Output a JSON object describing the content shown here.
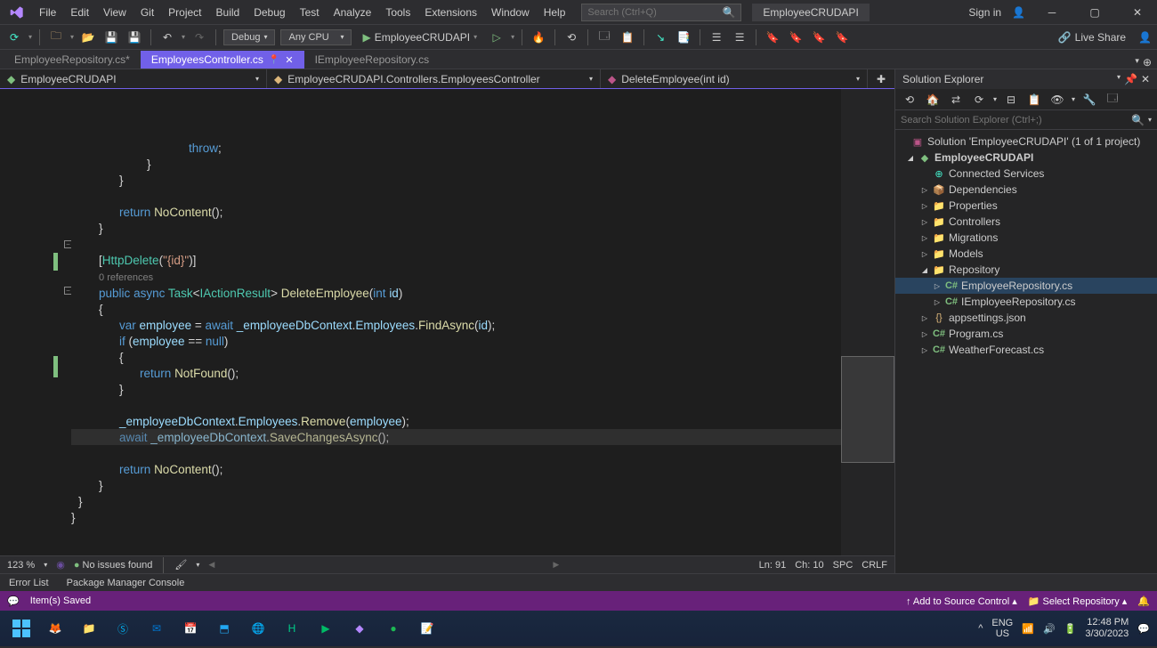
{
  "menus": [
    "File",
    "Edit",
    "View",
    "Git",
    "Project",
    "Build",
    "Debug",
    "Test",
    "Analyze",
    "Tools",
    "Extensions",
    "Window",
    "Help"
  ],
  "search_placeholder": "Search (Ctrl+Q)",
  "solution_label": "EmployeeCRUDAPI",
  "signin": "Sign in",
  "toolbar": {
    "config": "Debug",
    "platform": "Any CPU",
    "run": "EmployeeCRUDAPI",
    "live_share": "Live Share"
  },
  "tabs": [
    {
      "name": "EmployeeRepository.cs*",
      "active": false,
      "pinned": false
    },
    {
      "name": "EmployeesController.cs",
      "active": true,
      "pinned": true
    },
    {
      "name": "IEmployeeRepository.cs",
      "active": false,
      "pinned": false
    }
  ],
  "navbar": {
    "project": "EmployeeCRUDAPI",
    "class": "EmployeeCRUDAPI.Controllers.EmployeesController",
    "member": "DeleteEmployee(int id)"
  },
  "code_lines": [
    {
      "i": 36,
      "t": "                <kw>throw</kw><pun>;</pun>"
    },
    {
      "i": 20,
      "t": "            <pun>}</pun>"
    },
    {
      "i": 12,
      "t": "        <pun>}</pun>"
    },
    {
      "i": 0,
      "t": ""
    },
    {
      "i": 12,
      "t": "        <kw>return</kw> <mth>NoContent</mth><pun>();</pun>"
    },
    {
      "i": 8,
      "t": "    <pun>}</pun>"
    },
    {
      "i": 0,
      "t": ""
    },
    {
      "i": 8,
      "t": "    <pun>[</pun><type>HttpDelete</type><pun>(</pun><str>\"{id}\"</str><pun>)]</pun>"
    },
    {
      "i": 8,
      "t": "    <ref>0 references</ref>"
    },
    {
      "i": 8,
      "t": "    <kw>public</kw> <kw>async</kw> <type>Task</type><pun>&lt;</pun><type>IActionResult</type><pun>&gt;</pun> <mth>DeleteEmployee</mth><pun>(</pun><kw>int</kw> <var>id</var><pun>)</pun>"
    },
    {
      "i": 8,
      "t": "    <pun>{</pun>"
    },
    {
      "i": 12,
      "t": "        <kw>var</kw> <var>employee</var> <pun>=</pun> <kw>await</kw> <var>_employeeDbContext</var><pun>.</pun><var>Employees</var><pun>.</pun><mth>FindAsync</mth><pun>(</pun><var>id</var><pun>);</pun>"
    },
    {
      "i": 12,
      "t": "        <kw>if</kw> <pun>(</pun><var>employee</var> <pun>==</pun> <kw>null</kw><pun>)</pun>"
    },
    {
      "i": 12,
      "t": "        <pun>{</pun>"
    },
    {
      "i": 16,
      "t": "            <kw>return</kw> <mth>NotFound</mth><pun>();</pun>"
    },
    {
      "i": 12,
      "t": "        <pun>}</pun>"
    },
    {
      "i": 0,
      "t": ""
    },
    {
      "i": 12,
      "t": "        <var>_employeeDbContext</var><pun>.</pun><var>Employees</var><pun>.</pun><mth>Remove</mth><pun>(</pun><var>employee</var><pun>);</pun>"
    },
    {
      "i": 12,
      "t": "        <kw>await</kw> <var>_employeeDbContext</var><pun>.</pun><mth>SaveChangesAsync</mth><pun>();</pun>"
    },
    {
      "i": 0,
      "t": ""
    },
    {
      "i": 12,
      "t": "        <kw>return</kw> <mth>NoContent</mth><pun>();</pun>"
    },
    {
      "i": 8,
      "t": "    <pun>}</pun>"
    },
    {
      "i": 4,
      "t": "<pun>}</pun>"
    },
    {
      "i": 0,
      "t": "<pun>}</pun>"
    }
  ],
  "editor_status": {
    "zoom": "123 %",
    "issues": "No issues found",
    "ln": "Ln: 91",
    "ch": "Ch: 10",
    "enc": "SPC",
    "eol": "CRLF"
  },
  "sln": {
    "title": "Solution Explorer",
    "search": "Search Solution Explorer (Ctrl+;)",
    "root": "Solution 'EmployeeCRUDAPI' (1 of 1 project)",
    "project": "EmployeeCRUDAPI",
    "items": [
      {
        "name": "Connected Services",
        "icon": "link",
        "depth": 2,
        "exp": ""
      },
      {
        "name": "Dependencies",
        "icon": "pkg",
        "depth": 2,
        "exp": "▷"
      },
      {
        "name": "Properties",
        "icon": "folder",
        "depth": 2,
        "exp": "▷"
      },
      {
        "name": "Controllers",
        "icon": "folder",
        "depth": 2,
        "exp": "▷"
      },
      {
        "name": "Migrations",
        "icon": "folder",
        "depth": 2,
        "exp": "▷"
      },
      {
        "name": "Models",
        "icon": "folder",
        "depth": 2,
        "exp": "▷"
      },
      {
        "name": "Repository",
        "icon": "folder",
        "depth": 2,
        "exp": "◢"
      },
      {
        "name": "EmployeeRepository.cs",
        "icon": "cs",
        "depth": 3,
        "exp": "▷",
        "sel": true
      },
      {
        "name": "IEmployeeRepository.cs",
        "icon": "cs",
        "depth": 3,
        "exp": "▷"
      },
      {
        "name": "appsettings.json",
        "icon": "json",
        "depth": 2,
        "exp": "▷"
      },
      {
        "name": "Program.cs",
        "icon": "cs",
        "depth": 2,
        "exp": "▷"
      },
      {
        "name": "WeatherForecast.cs",
        "icon": "cs",
        "depth": 2,
        "exp": "▷"
      }
    ]
  },
  "bottom_tabs": [
    "Error List",
    "Package Manager Console"
  ],
  "status": {
    "saved": "Item(s) Saved",
    "source": "Add to Source Control",
    "repo": "Select Repository"
  },
  "tray": {
    "lang": "ENG",
    "region": "US",
    "time": "12:48 PM",
    "date": "3/30/2023"
  }
}
